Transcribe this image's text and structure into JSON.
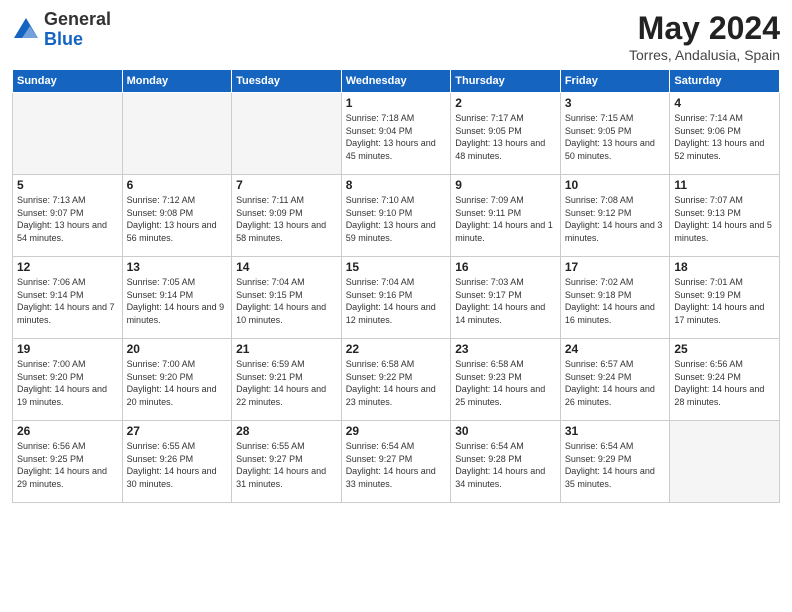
{
  "header": {
    "logo": {
      "general": "General",
      "blue": "Blue"
    },
    "month": "May 2024",
    "location": "Torres, Andalusia, Spain"
  },
  "weekdays": [
    "Sunday",
    "Monday",
    "Tuesday",
    "Wednesday",
    "Thursday",
    "Friday",
    "Saturday"
  ],
  "weeks": [
    [
      {
        "day": "",
        "info": ""
      },
      {
        "day": "",
        "info": ""
      },
      {
        "day": "",
        "info": ""
      },
      {
        "day": "1",
        "info": "Sunrise: 7:18 AM\nSunset: 9:04 PM\nDaylight: 13 hours\nand 45 minutes."
      },
      {
        "day": "2",
        "info": "Sunrise: 7:17 AM\nSunset: 9:05 PM\nDaylight: 13 hours\nand 48 minutes."
      },
      {
        "day": "3",
        "info": "Sunrise: 7:15 AM\nSunset: 9:05 PM\nDaylight: 13 hours\nand 50 minutes."
      },
      {
        "day": "4",
        "info": "Sunrise: 7:14 AM\nSunset: 9:06 PM\nDaylight: 13 hours\nand 52 minutes."
      }
    ],
    [
      {
        "day": "5",
        "info": "Sunrise: 7:13 AM\nSunset: 9:07 PM\nDaylight: 13 hours\nand 54 minutes."
      },
      {
        "day": "6",
        "info": "Sunrise: 7:12 AM\nSunset: 9:08 PM\nDaylight: 13 hours\nand 56 minutes."
      },
      {
        "day": "7",
        "info": "Sunrise: 7:11 AM\nSunset: 9:09 PM\nDaylight: 13 hours\nand 58 minutes."
      },
      {
        "day": "8",
        "info": "Sunrise: 7:10 AM\nSunset: 9:10 PM\nDaylight: 13 hours\nand 59 minutes."
      },
      {
        "day": "9",
        "info": "Sunrise: 7:09 AM\nSunset: 9:11 PM\nDaylight: 14 hours\nand 1 minute."
      },
      {
        "day": "10",
        "info": "Sunrise: 7:08 AM\nSunset: 9:12 PM\nDaylight: 14 hours\nand 3 minutes."
      },
      {
        "day": "11",
        "info": "Sunrise: 7:07 AM\nSunset: 9:13 PM\nDaylight: 14 hours\nand 5 minutes."
      }
    ],
    [
      {
        "day": "12",
        "info": "Sunrise: 7:06 AM\nSunset: 9:14 PM\nDaylight: 14 hours\nand 7 minutes."
      },
      {
        "day": "13",
        "info": "Sunrise: 7:05 AM\nSunset: 9:14 PM\nDaylight: 14 hours\nand 9 minutes."
      },
      {
        "day": "14",
        "info": "Sunrise: 7:04 AM\nSunset: 9:15 PM\nDaylight: 14 hours\nand 10 minutes."
      },
      {
        "day": "15",
        "info": "Sunrise: 7:04 AM\nSunset: 9:16 PM\nDaylight: 14 hours\nand 12 minutes."
      },
      {
        "day": "16",
        "info": "Sunrise: 7:03 AM\nSunset: 9:17 PM\nDaylight: 14 hours\nand 14 minutes."
      },
      {
        "day": "17",
        "info": "Sunrise: 7:02 AM\nSunset: 9:18 PM\nDaylight: 14 hours\nand 16 minutes."
      },
      {
        "day": "18",
        "info": "Sunrise: 7:01 AM\nSunset: 9:19 PM\nDaylight: 14 hours\nand 17 minutes."
      }
    ],
    [
      {
        "day": "19",
        "info": "Sunrise: 7:00 AM\nSunset: 9:20 PM\nDaylight: 14 hours\nand 19 minutes."
      },
      {
        "day": "20",
        "info": "Sunrise: 7:00 AM\nSunset: 9:20 PM\nDaylight: 14 hours\nand 20 minutes."
      },
      {
        "day": "21",
        "info": "Sunrise: 6:59 AM\nSunset: 9:21 PM\nDaylight: 14 hours\nand 22 minutes."
      },
      {
        "day": "22",
        "info": "Sunrise: 6:58 AM\nSunset: 9:22 PM\nDaylight: 14 hours\nand 23 minutes."
      },
      {
        "day": "23",
        "info": "Sunrise: 6:58 AM\nSunset: 9:23 PM\nDaylight: 14 hours\nand 25 minutes."
      },
      {
        "day": "24",
        "info": "Sunrise: 6:57 AM\nSunset: 9:24 PM\nDaylight: 14 hours\nand 26 minutes."
      },
      {
        "day": "25",
        "info": "Sunrise: 6:56 AM\nSunset: 9:24 PM\nDaylight: 14 hours\nand 28 minutes."
      }
    ],
    [
      {
        "day": "26",
        "info": "Sunrise: 6:56 AM\nSunset: 9:25 PM\nDaylight: 14 hours\nand 29 minutes."
      },
      {
        "day": "27",
        "info": "Sunrise: 6:55 AM\nSunset: 9:26 PM\nDaylight: 14 hours\nand 30 minutes."
      },
      {
        "day": "28",
        "info": "Sunrise: 6:55 AM\nSunset: 9:27 PM\nDaylight: 14 hours\nand 31 minutes."
      },
      {
        "day": "29",
        "info": "Sunrise: 6:54 AM\nSunset: 9:27 PM\nDaylight: 14 hours\nand 33 minutes."
      },
      {
        "day": "30",
        "info": "Sunrise: 6:54 AM\nSunset: 9:28 PM\nDaylight: 14 hours\nand 34 minutes."
      },
      {
        "day": "31",
        "info": "Sunrise: 6:54 AM\nSunset: 9:29 PM\nDaylight: 14 hours\nand 35 minutes."
      },
      {
        "day": "",
        "info": ""
      }
    ]
  ]
}
